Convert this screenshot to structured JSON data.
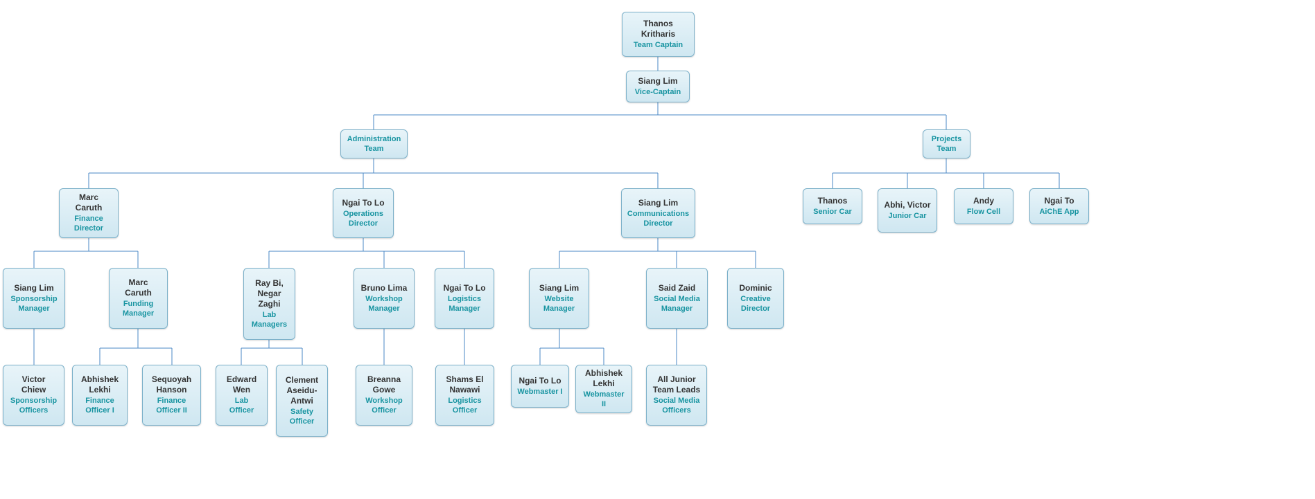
{
  "nodes": {
    "captain": {
      "name": "Thanos Kritharis",
      "title": "Team Captain"
    },
    "vice": {
      "name": "Siang Lim",
      "title": "Vice-Captain"
    },
    "admin": {
      "name": "",
      "title": "Administration Team"
    },
    "projects": {
      "name": "",
      "title": "Projects Team"
    },
    "marc": {
      "name": "Marc Caruth",
      "title": "Finance Director"
    },
    "ngai_dir": {
      "name": "Ngai To Lo",
      "title": "Operations Director"
    },
    "siang_dir": {
      "name": "Siang Lim",
      "title": "Communications Director"
    },
    "sponsor_mgr": {
      "name": "Siang Lim",
      "title": "Sponsorship Manager"
    },
    "funding_mgr": {
      "name": "Marc Caruth",
      "title": "Funding Manager"
    },
    "lab_mgr": {
      "name": "Ray Bi, Negar Zaghi",
      "title": "Lab Managers"
    },
    "workshop_mgr": {
      "name": "Bruno Lima",
      "title": "Workshop Manager"
    },
    "logistic_mgr": {
      "name": "Ngai To Lo",
      "title": "Logistics Manager"
    },
    "web_mgr": {
      "name": "Siang Lim",
      "title": "Website Manager"
    },
    "social_mgr": {
      "name": "Said Zaid",
      "title": "Social Media Manager"
    },
    "creative": {
      "name": "Dominic",
      "title": "Creative Director"
    },
    "victor": {
      "name": "Victor Chiew",
      "title": "Sponsorship Officers"
    },
    "abhishek1": {
      "name": "Abhishek Lekhi",
      "title": "Finance Officer I"
    },
    "sequoyah": {
      "name": "Sequoyah Hanson",
      "title": "Finance Officer II"
    },
    "edward": {
      "name": "Edward Wen",
      "title": "Lab Officer"
    },
    "clement": {
      "name": "Clement Aseidu-Antwi",
      "title": "Safety Officer"
    },
    "breanna": {
      "name": "Breanna Gowe",
      "title": "Workshop Officer"
    },
    "shams": {
      "name": "Shams El Nawawi",
      "title": "Logistics Officer"
    },
    "ngai_web": {
      "name": "Ngai To Lo",
      "title": "Webmaster I"
    },
    "abhishek2": {
      "name": "Abhishek Lekhi",
      "title": "Webmaster II"
    },
    "junior": {
      "name": "All Junior Team Leads",
      "title": "Social Media Officers"
    },
    "thanos_p": {
      "name": "Thanos",
      "title": "Senior Car"
    },
    "abhi_v": {
      "name": "Abhi, Victor",
      "title": "Junior Car"
    },
    "andy": {
      "name": "Andy",
      "title": "Flow Cell"
    },
    "ngai_p": {
      "name": "Ngai To",
      "title": "AiChE App"
    }
  }
}
